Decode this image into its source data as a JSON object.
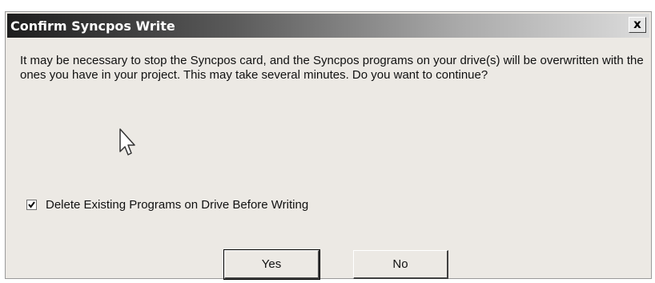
{
  "dialog": {
    "title": "Confirm Syncpos Write",
    "close_label": "x",
    "message": "It may be necessary to stop the Syncpos card, and the Syncpos programs on your drive(s) will be overwritten with the ones you have in your project.  This may take several minutes.  Do you want to continue?",
    "checkbox": {
      "label": "Delete Existing Programs on Drive Before Writing",
      "checked": true
    },
    "buttons": {
      "yes_label": "Yes",
      "no_label": "No"
    }
  },
  "icons": {
    "close": "close-icon",
    "cursor": "mouse-pointer-icon",
    "check": "checkmark-icon"
  }
}
